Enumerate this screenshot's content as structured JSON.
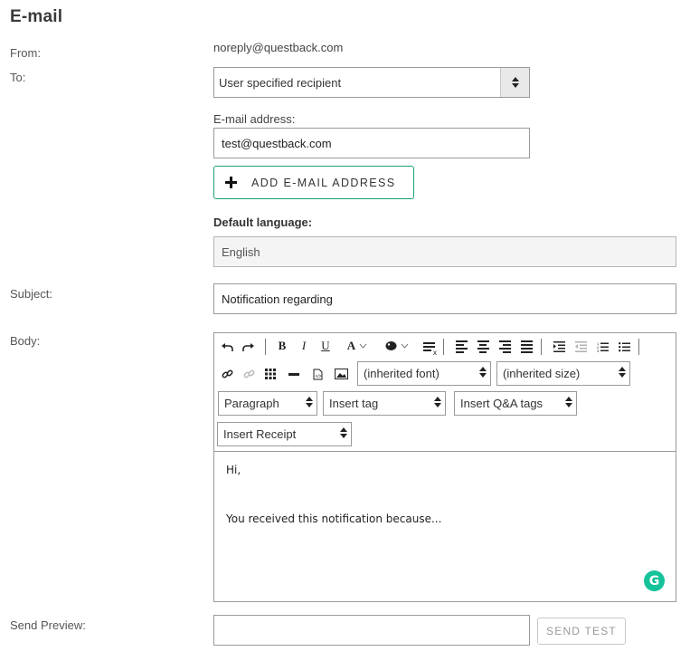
{
  "page": {
    "title": "E-mail"
  },
  "from": {
    "label": "From:",
    "value": "noreply@questback.com"
  },
  "to": {
    "label": "To:",
    "select_value": "User specified recipient",
    "email_label": "E-mail address:",
    "email_value": "test@questback.com",
    "add_button": "ADD E-MAIL ADDRESS"
  },
  "language": {
    "label": "Default language:",
    "value": "English"
  },
  "subject": {
    "label": "Subject:",
    "value": "Notification regarding"
  },
  "body": {
    "label": "Body:",
    "toolbar": {
      "font_select": "(inherited font)",
      "size_select": "(inherited size)",
      "format_select": "Paragraph",
      "tag_select": "Insert tag",
      "qa_select": "Insert Q&A tags",
      "receipt_select": "Insert Receipt",
      "bold": "B",
      "italic": "I",
      "underline": "U",
      "font_color": "A",
      "grammarly": "G"
    },
    "content": {
      "line1": "Hi,",
      "line2": "You received this notification because..."
    }
  },
  "preview": {
    "label": "Send Preview:",
    "input_value": "",
    "button": "SEND TEST"
  },
  "colors": {
    "accent": "#1aa37a",
    "grammarly": "#15c39a",
    "border": "#9a9a9a"
  }
}
